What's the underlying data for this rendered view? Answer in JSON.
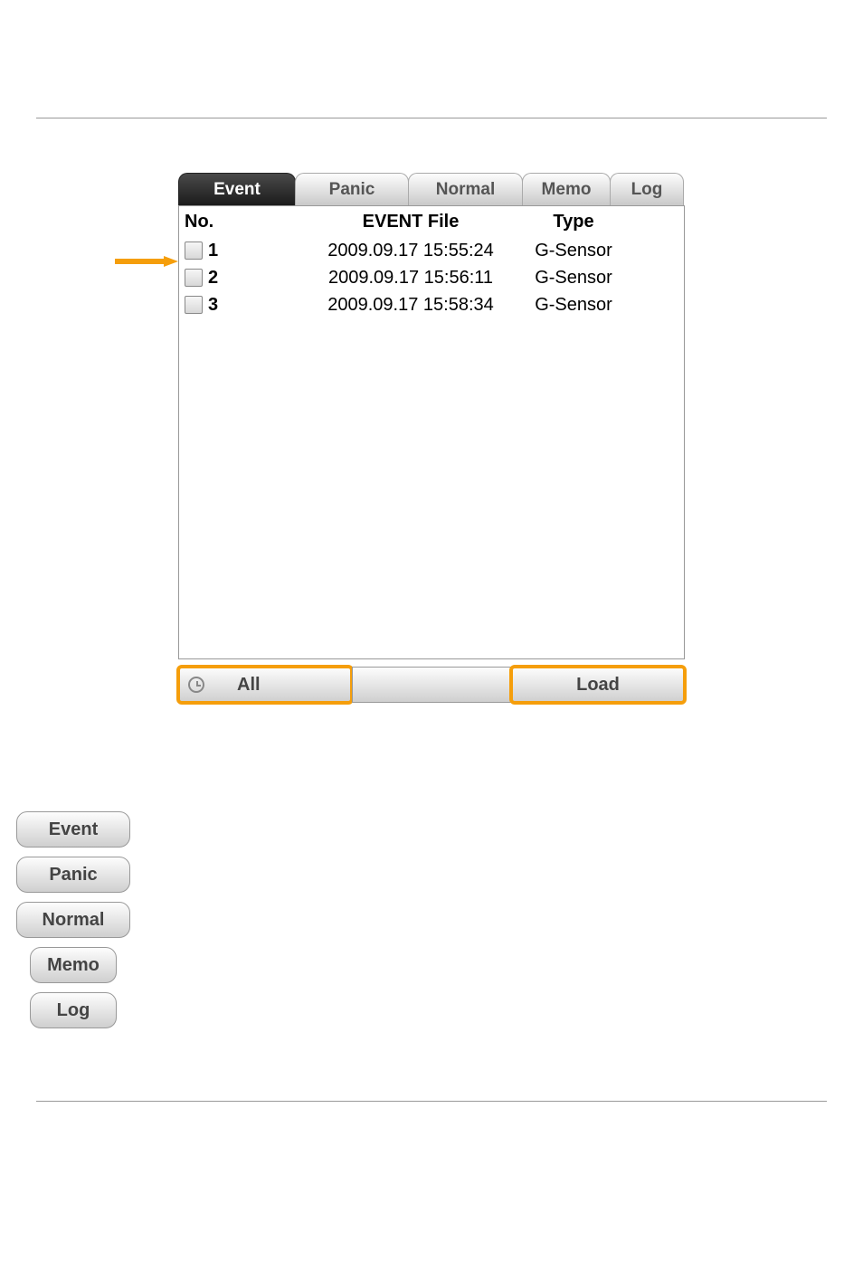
{
  "tabs": {
    "event": "Event",
    "panic": "Panic",
    "normal": "Normal",
    "memo": "Memo",
    "log": "Log"
  },
  "list": {
    "header": {
      "no": "No.",
      "file": "EVENT File",
      "type": "Type"
    },
    "rows": [
      {
        "no": "1",
        "file": "2009.09.17 15:55:24",
        "type": "G-Sensor"
      },
      {
        "no": "2",
        "file": "2009.09.17 15:56:11",
        "type": "G-Sensor"
      },
      {
        "no": "3",
        "file": "2009.09.17 15:58:34",
        "type": "G-Sensor"
      }
    ]
  },
  "buttons": {
    "all": "All",
    "load": "Load"
  },
  "standalone": {
    "event": "Event",
    "panic": "Panic",
    "normal": "Normal",
    "memo": "Memo",
    "log": "Log"
  }
}
